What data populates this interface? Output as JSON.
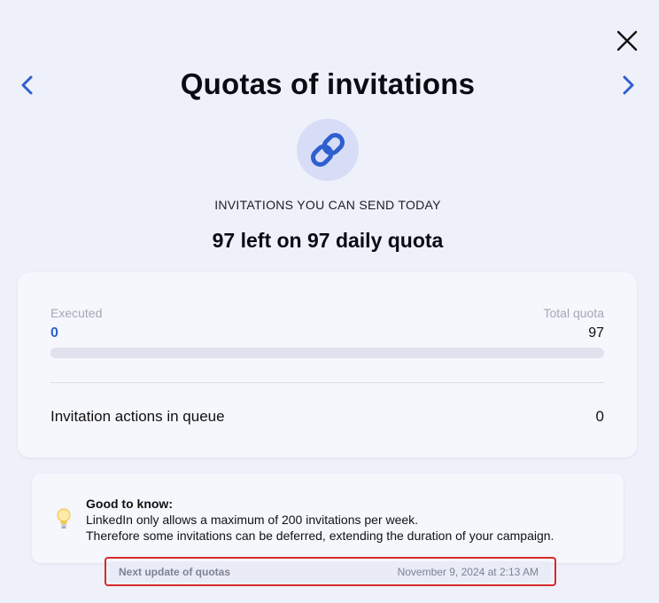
{
  "modal": {
    "title": "Quotas of invitations",
    "subtitle": "INVITATIONS YOU CAN SEND TODAY",
    "summary": "97 left on 97 daily quota"
  },
  "icons": {
    "close": "close-icon",
    "prev": "chevron-left-icon",
    "next": "chevron-right-icon",
    "hero": "link-icon",
    "tip": "lightbulb-icon"
  },
  "quota": {
    "executed_label": "Executed",
    "executed_value": "0",
    "total_label": "Total quota",
    "total_value": "97",
    "progress_fraction": 0,
    "queue_label": "Invitation actions in queue",
    "queue_value": "0"
  },
  "info": {
    "title": "Good to know:",
    "line1": "LinkedIn only allows a maximum of 200 invitations per week.",
    "line2": "Therefore some invitations can be deferred, extending the duration of your campaign."
  },
  "next_update": {
    "label": "Next update of quotas",
    "value": "November 9, 2024 at 2:13 AM"
  },
  "colors": {
    "accent": "#2f5fd0",
    "highlight_border": "#d82a2a",
    "background": "#eef1fa"
  }
}
